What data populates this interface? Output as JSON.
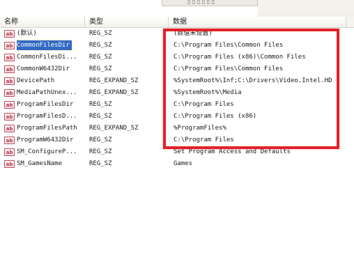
{
  "dialog_fragment": {
    "label": "▯ ▯ ▯ ▯ ▯ ▯"
  },
  "columns": {
    "name": "名称",
    "type": "类型",
    "data": "数据"
  },
  "rows": [
    {
      "name": "(默认)",
      "type": "REG_SZ",
      "data": "(数值未设置)",
      "icon": "ab",
      "selected": false
    },
    {
      "name": "CommonFilesDir",
      "type": "REG_SZ",
      "data": "C:\\Program Files\\Common Files",
      "icon": "ab",
      "selected": true
    },
    {
      "name": "CommonFilesDi...",
      "type": "REG_SZ",
      "data": "C:\\Program Files (x86)\\Common Files",
      "icon": "ab",
      "selected": false
    },
    {
      "name": "CommonW6432Dir",
      "type": "REG_SZ",
      "data": "C:\\Program Files\\Common Files",
      "icon": "ab",
      "selected": false
    },
    {
      "name": "DevicePath",
      "type": "REG_EXPAND_SZ",
      "data": "%SystemRoot%\\Inf;C:\\Drivers\\Video.Intel.HD",
      "icon": "ab",
      "selected": false
    },
    {
      "name": "MediaPathUnex...",
      "type": "REG_EXPAND_SZ",
      "data": "%SystemRoot%\\Media",
      "icon": "ab",
      "selected": false
    },
    {
      "name": "ProgramFilesDir",
      "type": "REG_SZ",
      "data": "C:\\Program Files",
      "icon": "ab",
      "selected": false
    },
    {
      "name": "ProgramFilesD...",
      "type": "REG_SZ",
      "data": "C:\\Program Files (x86)",
      "icon": "ab",
      "selected": false
    },
    {
      "name": "ProgramFilesPath",
      "type": "REG_EXPAND_SZ",
      "data": "%ProgramFiles%",
      "icon": "ab",
      "selected": false
    },
    {
      "name": "ProgramW6432Dir",
      "type": "REG_SZ",
      "data": "C:\\Program Files",
      "icon": "ab",
      "selected": false
    },
    {
      "name": "SM_ConfigureP...",
      "type": "REG_SZ",
      "data": "Set Program Access and Defaults",
      "icon": "ab",
      "selected": false
    },
    {
      "name": "SM_GamesName",
      "type": "REG_SZ",
      "data": "Games",
      "icon": "ab",
      "selected": false
    }
  ],
  "colors": {
    "selection": "#316ac5",
    "highlight_box": "#e4202a",
    "icon_accent": "#b8304a"
  }
}
